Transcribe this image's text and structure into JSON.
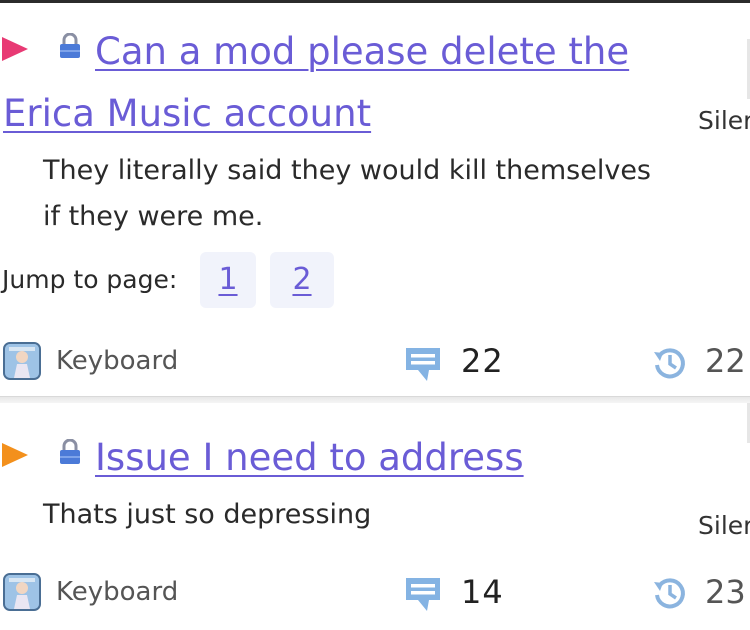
{
  "topics": [
    {
      "title_line1": "Can a mod please delete the",
      "title_line2": "Erica Music account",
      "excerpt_line1": "They literally said they would kill themselves",
      "excerpt_line2": "if they were me.",
      "side_label": "Siler",
      "jump_label": "Jump to page:",
      "pages": [
        "1",
        "2"
      ],
      "author": "Keyboard",
      "replies": "22",
      "activity": "22",
      "flag_color": "#e83a74"
    },
    {
      "title_line1": "Issue I need to address",
      "excerpt_line1": "Thats just so depressing",
      "side_label": "Siler",
      "author": "Keyboard",
      "replies": "14",
      "activity": "23",
      "flag_color": "#f3901c"
    }
  ],
  "icons": {
    "flag": "triangle-flag-icon",
    "lock": "lock-icon",
    "comment": "comment-icon",
    "history": "history-icon",
    "avatar": "avatar"
  }
}
